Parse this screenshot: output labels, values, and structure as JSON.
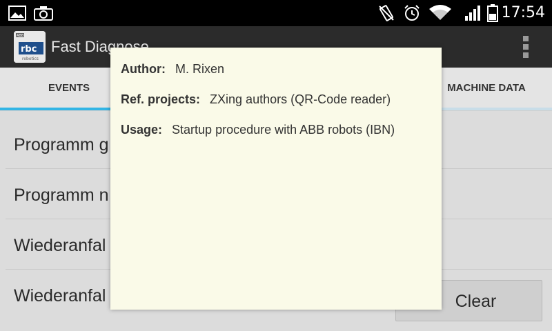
{
  "status_bar": {
    "time": "17:54",
    "left_icons": [
      "image-icon",
      "camera-icon"
    ],
    "right_icons": [
      "vibrate-icon",
      "alarm-icon",
      "wifi-icon",
      "signal-icon",
      "battery-icon"
    ]
  },
  "action_bar": {
    "title": "Fast Diagnose",
    "logo_text": "rbc",
    "logo_top": "ABB",
    "logo_bottom": "robotics"
  },
  "tabs": [
    {
      "label": "EVENTS",
      "active": true
    },
    {
      "label": "MACHINE DATA",
      "active": false
    }
  ],
  "events": [
    "Programm g",
    "Programm n",
    "Wiederanfal",
    "Wiederanfal"
  ],
  "clear_label": "Clear",
  "dialog": {
    "author_label": "Author:",
    "author_value": "M. Rixen",
    "ref_label": "Ref. projects:",
    "ref_value": "ZXing authors (QR-Code reader)",
    "usage_label": "Usage:",
    "usage_value": "Startup procedure with ABB robots (IBN)"
  },
  "colors": {
    "accent": "#33b5e5",
    "dialog_bg": "#fafae8",
    "action_bar_bg": "#2b2b2b"
  }
}
